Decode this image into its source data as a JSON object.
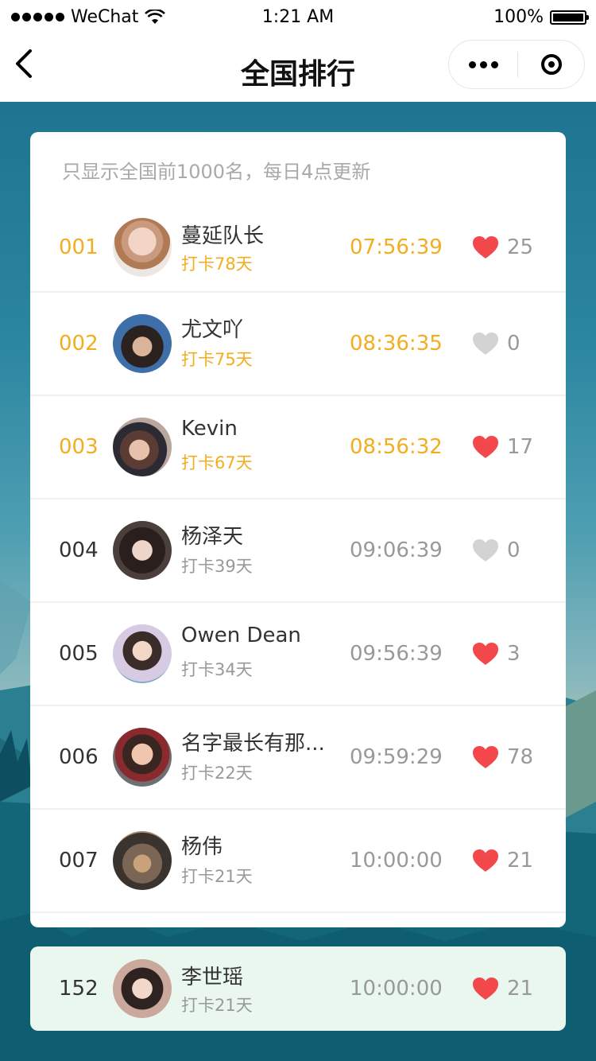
{
  "status_bar": {
    "carrier": "WeChat",
    "time": "1:21 AM",
    "battery": "100%"
  },
  "nav": {
    "title": "全国排行"
  },
  "notice": "只显示全国前1000名，每日4点更新",
  "colors": {
    "gold": "#f3ad1f",
    "heart_active": "#f2484b",
    "heart_inactive": "#d3d3d3",
    "my_rank_bg": "#eaf7ef"
  },
  "ranking": [
    {
      "rank": "001",
      "name": "蔓延队长",
      "days": "打卡78天",
      "time": "07:56:39",
      "likes": "25",
      "liked": true,
      "top": true
    },
    {
      "rank": "002",
      "name": "尤文吖",
      "days": "打卡75天",
      "time": "08:36:35",
      "likes": "0",
      "liked": false,
      "top": true
    },
    {
      "rank": "003",
      "name": "Kevin",
      "days": "打卡67天",
      "time": "08:56:32",
      "likes": "17",
      "liked": true,
      "top": true
    },
    {
      "rank": "004",
      "name": "杨泽天",
      "days": "打卡39天",
      "time": "09:06:39",
      "likes": "0",
      "liked": false,
      "top": false
    },
    {
      "rank": "005",
      "name": "Owen Dean",
      "days": "打卡34天",
      "time": "09:56:39",
      "likes": "3",
      "liked": true,
      "top": false
    },
    {
      "rank": "006",
      "name": "名字最长有那...",
      "days": "打卡22天",
      "time": "09:59:29",
      "likes": "78",
      "liked": true,
      "top": false
    },
    {
      "rank": "007",
      "name": "杨伟",
      "days": "打卡21天",
      "time": "10:00:00",
      "likes": "21",
      "liked": true,
      "top": false
    }
  ],
  "my_rank": {
    "rank": "152",
    "name": "李世瑶",
    "days": "打卡21天",
    "time": "10:00:00",
    "likes": "21",
    "liked": true
  }
}
